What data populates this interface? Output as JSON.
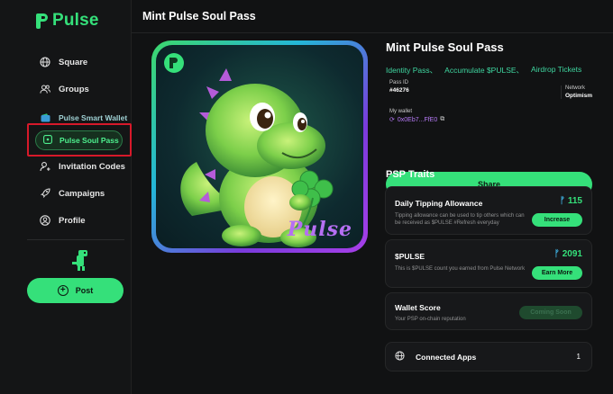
{
  "app": {
    "name": "Pulse"
  },
  "sidebar": {
    "items": [
      {
        "label": "Square",
        "icon": "globe-icon"
      },
      {
        "label": "Groups",
        "icon": "users-icon"
      },
      {
        "label": "Pulse Smart Wallet",
        "icon": "wallet-icon"
      },
      {
        "label": "Pulse Soul Pass",
        "icon": "pass-icon",
        "active": true
      },
      {
        "label": "Invitation Codes",
        "icon": "user-add-icon"
      },
      {
        "label": "Campaigns",
        "icon": "rocket-icon"
      },
      {
        "label": "Profile",
        "icon": "profile-icon"
      }
    ],
    "post_label": "Post"
  },
  "header": {
    "title": "Mint Pulse Soul Pass"
  },
  "artwork": {
    "label": "Pulse"
  },
  "pass": {
    "title": "Mint Pulse Soul Pass",
    "tags": [
      "Identity Pass、",
      "Accumulate $PULSE、",
      "Airdrop Tickets"
    ],
    "pass_id_label": "Pass ID",
    "pass_id": "#46276",
    "network_label": "Network",
    "network": "Optimism",
    "wallet_label": "My wallet",
    "wallet": "0x0Eb7...FfE0",
    "share_label": "Share"
  },
  "psp": {
    "title": "PSP Traits",
    "daily": {
      "title": "Daily Tipping Allowance",
      "desc": "Tipping allowance can be used to tip others which can be received as $PULSE #Refresh everyday",
      "value": "115",
      "button": "Increase"
    },
    "pulse": {
      "title": "$PULSE",
      "desc": "This is $PULSE count you earned from Pulse Network",
      "value": "2091",
      "button": "Earn More"
    },
    "score": {
      "title": "Wallet Score",
      "desc": "Your PSP on-chain reputation",
      "button": "Coming Soon"
    },
    "apps": {
      "label": "Connected Apps",
      "count": "1"
    }
  },
  "colors": {
    "accent": "#35e07a",
    "purple": "#b579f5",
    "teal": "#3fd6a0",
    "highlight": "#d7192a"
  }
}
